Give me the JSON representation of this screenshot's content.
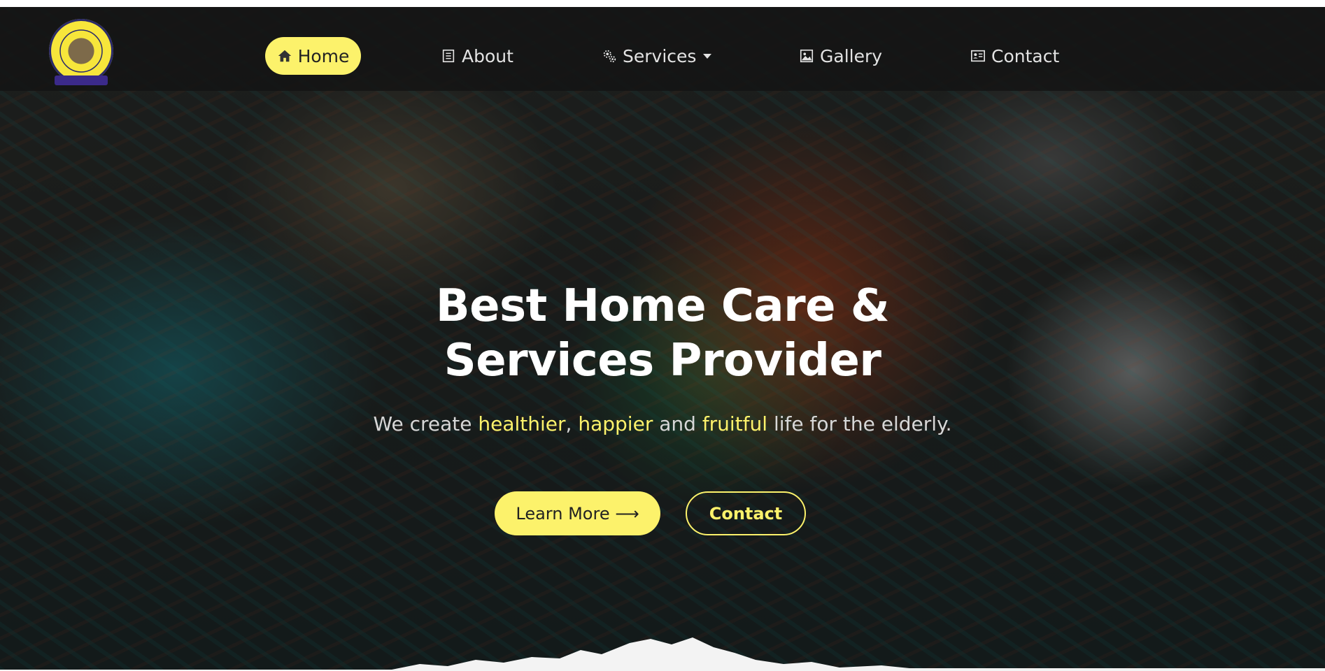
{
  "colors": {
    "accent": "#fcf26b",
    "nav_bg": "#141414",
    "text_light": "#e3e3e3"
  },
  "logo": {
    "alt": "OMOJOLAGBE GERIATRIC CARE FOUNDATION"
  },
  "nav": {
    "items": [
      {
        "label": "Home",
        "icon": "home-icon",
        "active": true
      },
      {
        "label": "About",
        "icon": "document-list-icon"
      },
      {
        "label": "Services",
        "icon": "gears-icon",
        "has_dropdown": true
      },
      {
        "label": "Gallery",
        "icon": "image-icon"
      },
      {
        "label": "Contact",
        "icon": "contact-card-icon"
      }
    ]
  },
  "hero": {
    "title_line1": "Best Home Care &",
    "title_line2": "Services Provider",
    "subtitle": {
      "part1": "We create ",
      "hl1": "healthier",
      "part2": ", ",
      "hl2": "happier",
      "part3": " and ",
      "hl3": "fruitful",
      "part4": " life for the elderly."
    },
    "primary_button": "Learn More ⟶",
    "secondary_button": "Contact"
  }
}
